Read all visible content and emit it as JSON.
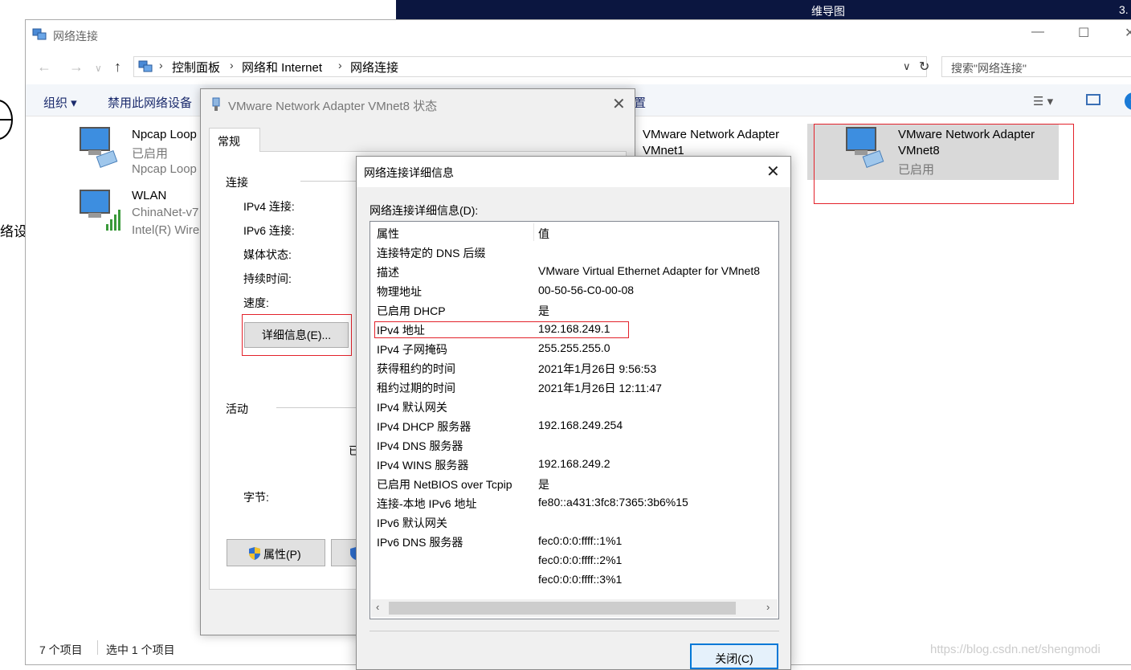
{
  "background": {
    "fragment_top_a": "维导图",
    "fragment_top_b": "3.",
    "fragment_left": "络设"
  },
  "explorer": {
    "title": "网络连接",
    "breadcrumb": [
      "控制面板",
      "网络和 Internet",
      "网络连接"
    ],
    "search_placeholder": "搜索\"网络连接\"",
    "toolbar": {
      "organize": "组织 ▾",
      "disable": "禁用此网络设备",
      "fragment": "置"
    },
    "adapters": [
      {
        "name": "Npcap Loop",
        "status": "已启用",
        "device": "Npcap Loop"
      },
      {
        "name": "WLAN",
        "status": "ChinaNet-v7",
        "device": "Intel(R) Wire"
      },
      {
        "name": "VMware Network Adapter",
        "status": "VMnet1"
      },
      {
        "name": "VMware Network Adapter",
        "name2": "VMnet8",
        "status": "已启用"
      }
    ],
    "status_bar": {
      "count": "7 个项目",
      "selected": "选中 1 个项目"
    }
  },
  "status_dialog": {
    "title": "VMware Network Adapter VMnet8 状态",
    "tab": "常规",
    "group_connection": "连接",
    "ipv4": "IPv4 连接:",
    "ipv6": "IPv6 连接:",
    "media": "媒体状态:",
    "duration": "持续时间:",
    "speed": "速度:",
    "details_button": "详细信息(E)...",
    "group_activity": "活动",
    "activity_fragment": "已",
    "bytes": "字节:",
    "properties_button": "属性(P)"
  },
  "details_dialog": {
    "title": "网络连接详细信息",
    "label": "网络连接详细信息(D):",
    "headers": [
      "属性",
      "值"
    ],
    "rows": [
      [
        "连接特定的 DNS 后缀",
        ""
      ],
      [
        "描述",
        "VMware Virtual Ethernet Adapter for VMnet8"
      ],
      [
        "物理地址",
        "00-50-56-C0-00-08"
      ],
      [
        "已启用 DHCP",
        "是"
      ],
      [
        "IPv4 地址",
        "192.168.249.1"
      ],
      [
        "IPv4 子网掩码",
        "255.255.255.0"
      ],
      [
        "获得租约的时间",
        "2021年1月26日 9:56:53"
      ],
      [
        "租约过期的时间",
        "2021年1月26日 12:11:47"
      ],
      [
        "IPv4 默认网关",
        ""
      ],
      [
        "IPv4 DHCP 服务器",
        "192.168.249.254"
      ],
      [
        "IPv4 DNS 服务器",
        ""
      ],
      [
        "IPv4 WINS 服务器",
        "192.168.249.2"
      ],
      [
        "已启用 NetBIOS over Tcpip",
        "是"
      ],
      [
        "连接-本地 IPv6 地址",
        "fe80::a431:3fc8:7365:3b6%15"
      ],
      [
        "IPv6 默认网关",
        ""
      ],
      [
        "IPv6 DNS 服务器",
        "fec0:0:0:ffff::1%1"
      ],
      [
        "",
        "fec0:0:0:ffff::2%1"
      ],
      [
        "",
        "fec0:0:0:ffff::3%1"
      ]
    ],
    "close_button": "关闭(C)"
  },
  "watermark": "https://blog.csdn.net/shengmodi"
}
